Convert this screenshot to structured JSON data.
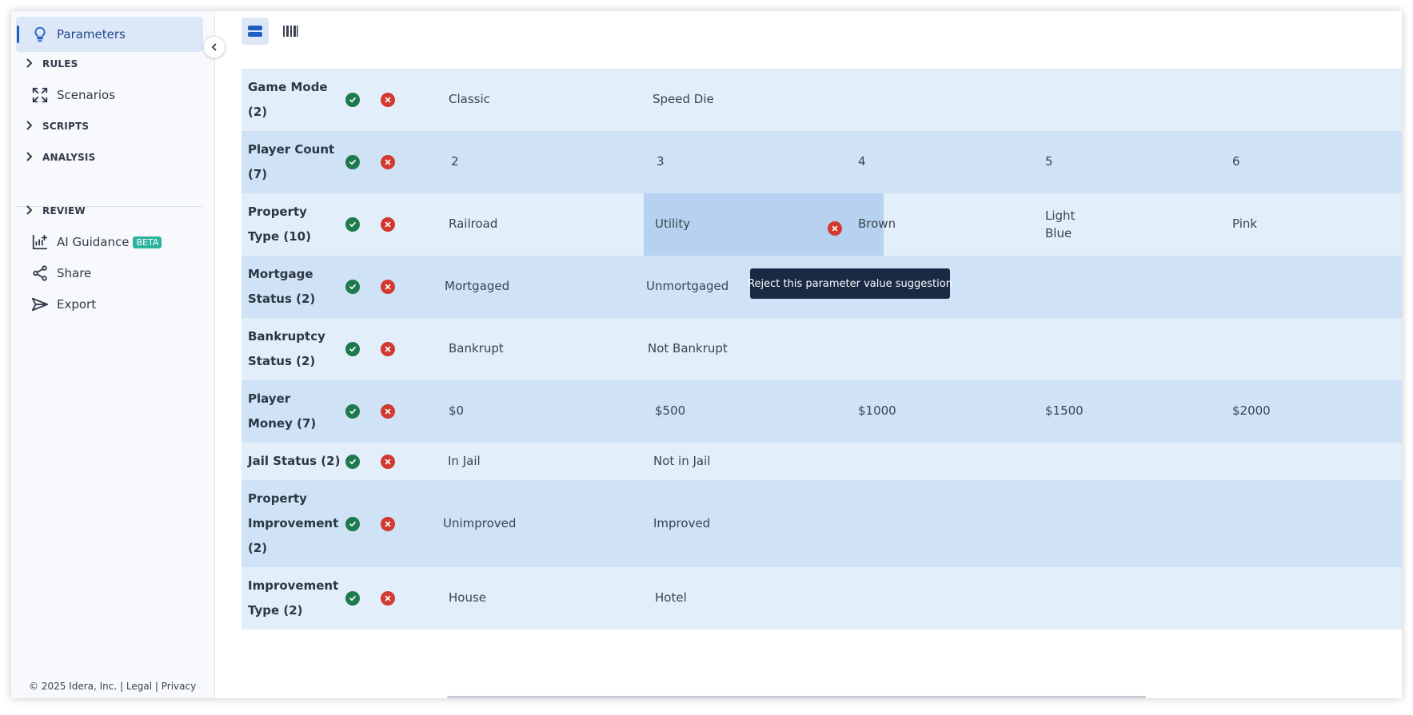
{
  "sidebar": {
    "parameters_label": "Parameters",
    "rules_label": "RULES",
    "scenarios_label": "Scenarios",
    "scripts_label": "SCRIPTS",
    "analysis_label": "ANALYSIS",
    "review_label": "REVIEW",
    "ai_guidance_label": "AI Guidance",
    "beta_badge": "BETA",
    "share_label": "Share",
    "export_label": "Export",
    "footer": {
      "copyright": "© 2025 Idera, Inc.",
      "sep1": "|",
      "legal": "Legal",
      "sep2": "|",
      "privacy": "Privacy"
    }
  },
  "colors": {
    "accent": "#1f5fbf",
    "accept": "#1e7a4c",
    "reject": "#d23a30",
    "row_light": "#e3eefb",
    "row_dark": "#d0e2f6",
    "highlight": "#b6d2f0",
    "tooltip_bg": "#1a2a45",
    "beta": "#2bb3a0"
  },
  "icons": {
    "parameters": "lightbulb-icon",
    "scenarios": "expand-arrows-icon",
    "ai_guidance": "chart-plus-icon",
    "share": "share-icon",
    "export": "send-icon",
    "collapse": "chevron-left-icon",
    "list_view": "list-view-icon",
    "grid_view": "barcode-view-icon",
    "accept": "check-circle-icon",
    "reject": "x-circle-icon"
  },
  "tooltip": "Reject this parameter value suggestion",
  "parameters": [
    {
      "name_lines": [
        "Game Mode",
        "(2)"
      ],
      "values": [
        "Classic",
        "Speed Die"
      ]
    },
    {
      "name_lines": [
        "Player Count",
        "(7)"
      ],
      "values": [
        "2",
        "3",
        "4",
        "5",
        "6"
      ]
    },
    {
      "name_lines": [
        "Property",
        "Type (10)"
      ],
      "values": [
        "Railroad",
        "Utility",
        "Brown",
        "Light Blue",
        "Pink"
      ],
      "value_lines_3": [
        "Light",
        "Blue"
      ]
    },
    {
      "name_lines": [
        "Mortgage",
        "Status (2)"
      ],
      "values": [
        "Mortgaged",
        "Unmortgaged"
      ]
    },
    {
      "name_lines": [
        "Bankruptcy",
        "Status (2)"
      ],
      "values": [
        "Bankrupt",
        "Not Bankrupt"
      ]
    },
    {
      "name_lines": [
        "Player",
        "Money (7)"
      ],
      "values": [
        "$0",
        "$500",
        "$1000",
        "$1500",
        "$2000"
      ]
    },
    {
      "name_lines": [
        "Jail Status (2)"
      ],
      "values": [
        "In Jail",
        "Not in Jail"
      ]
    },
    {
      "name_lines": [
        "Property",
        "Improvement",
        "(2)"
      ],
      "values": [
        "Unimproved",
        "Improved"
      ]
    },
    {
      "name_lines": [
        "Improvement",
        "Type (2)"
      ],
      "values": [
        "House",
        "Hotel"
      ]
    }
  ]
}
